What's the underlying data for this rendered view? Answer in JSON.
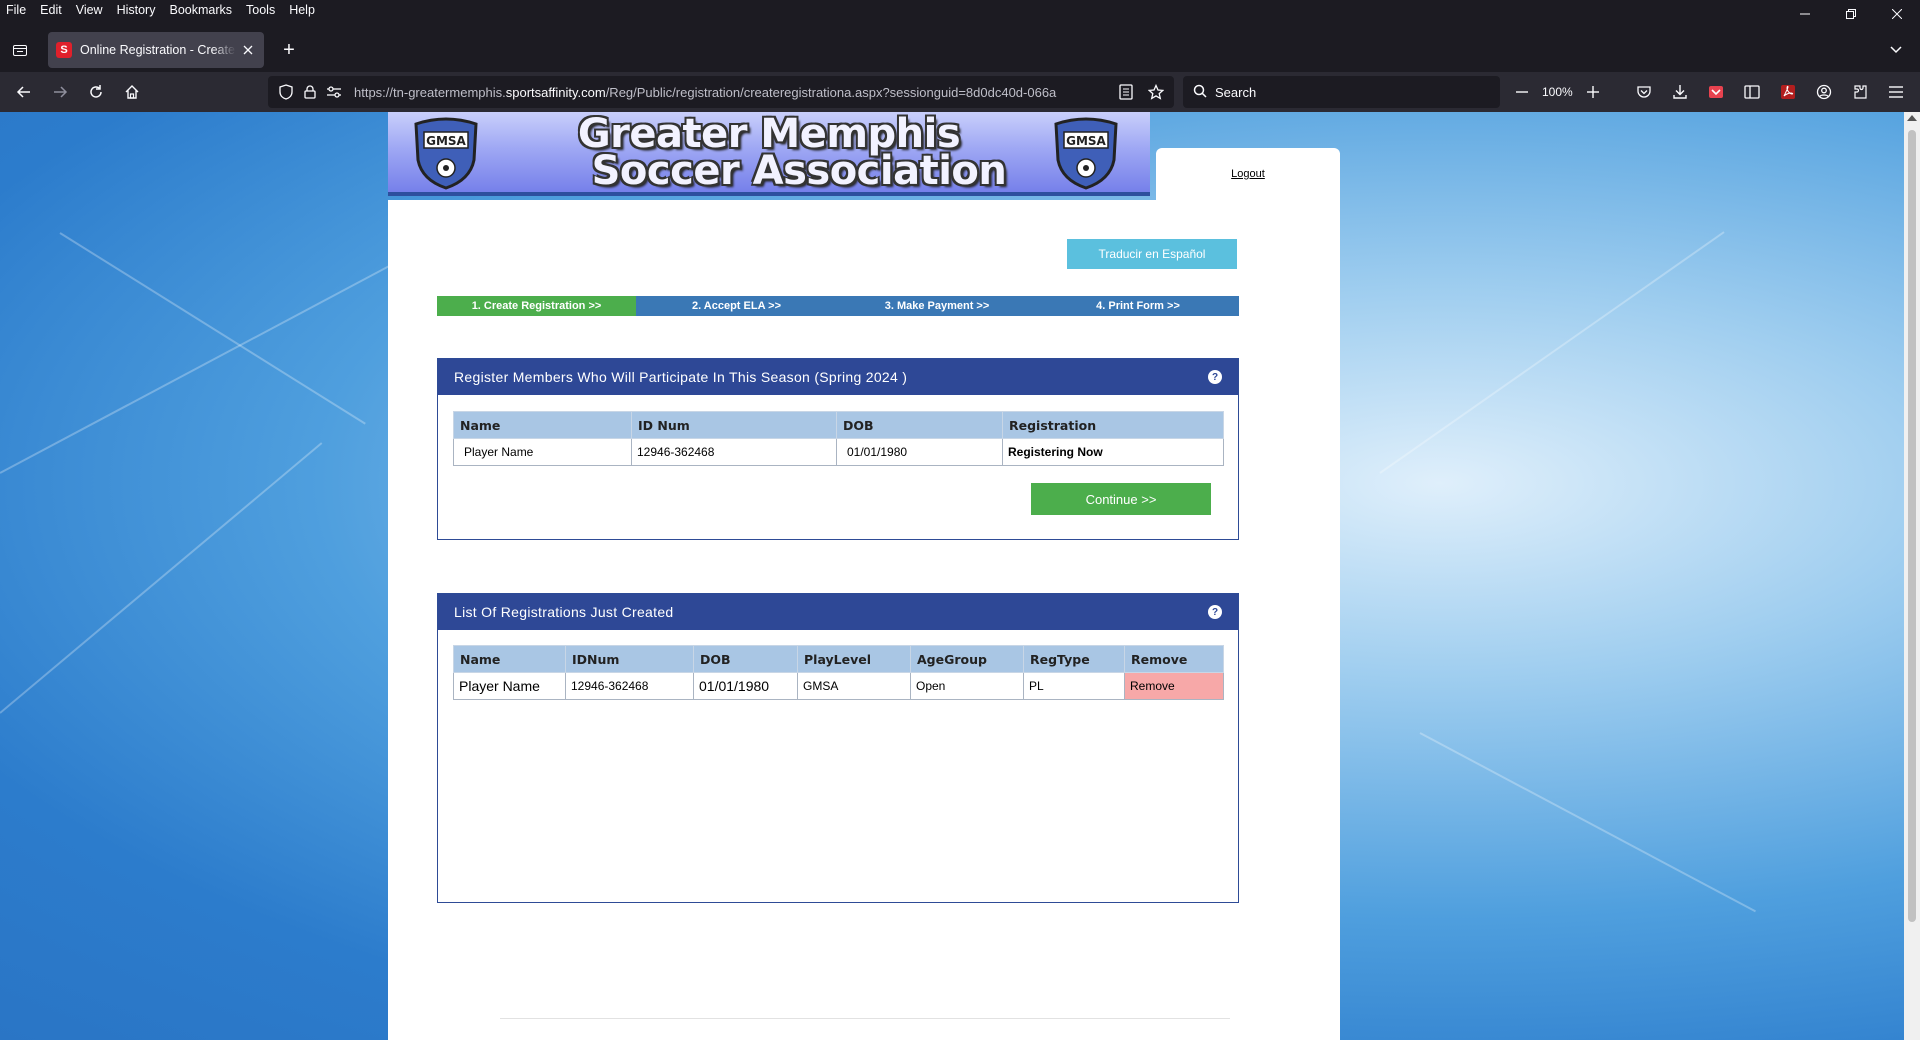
{
  "menu": [
    "File",
    "Edit",
    "View",
    "History",
    "Bookmarks",
    "Tools",
    "Help"
  ],
  "tab": {
    "title": "Online Registration - Create Registration"
  },
  "urlbar": {
    "prefix": "https://tn-greatermemphis.",
    "domain": "sportsaffinity.com",
    "path": "/Reg/Public/registration/createregistrationa.aspx?sessionguid=8d0dc40d-066a"
  },
  "search": {
    "placeholder": "Search"
  },
  "zoom": {
    "level": "100%"
  },
  "page": {
    "banner_title_line1": "Greater Memphis",
    "banner_title_line2": "Soccer Association",
    "crest_text": "GMSA",
    "logout": "Logout",
    "translate": "Traducir en Español",
    "steps": [
      {
        "label": "1. Create Registration >>",
        "active": true
      },
      {
        "label": "2. Accept ELA >>",
        "active": false
      },
      {
        "label": "3. Make Payment >>",
        "active": false
      },
      {
        "label": "4. Print Form >>",
        "active": false
      }
    ],
    "register_section": {
      "title": "Register Members Who Will Participate In This Season (Spring 2024 )",
      "headers": [
        "Name",
        "ID Num",
        "DOB",
        "Registration"
      ],
      "rows": [
        [
          "Player Name",
          "12946-362468",
          "01/01/1980",
          "Registering Now"
        ]
      ],
      "continue": "Continue >>"
    },
    "list_section": {
      "title": "List Of Registrations Just Created",
      "headers": [
        "Name",
        "IDNum",
        "DOB",
        "PlayLevel",
        "AgeGroup",
        "RegType",
        "Remove"
      ],
      "rows": [
        [
          "Player Name",
          "12946-362468",
          "01/01/1980",
          "GMSA",
          "Open",
          "PL",
          "Remove"
        ]
      ]
    }
  },
  "colors": {
    "accent_blue": "#2e4896",
    "step_blue": "#3a78b5",
    "success_green": "#4cae4c",
    "info_cyan": "#5bc0de",
    "remove_pink": "#f7a8a8"
  }
}
